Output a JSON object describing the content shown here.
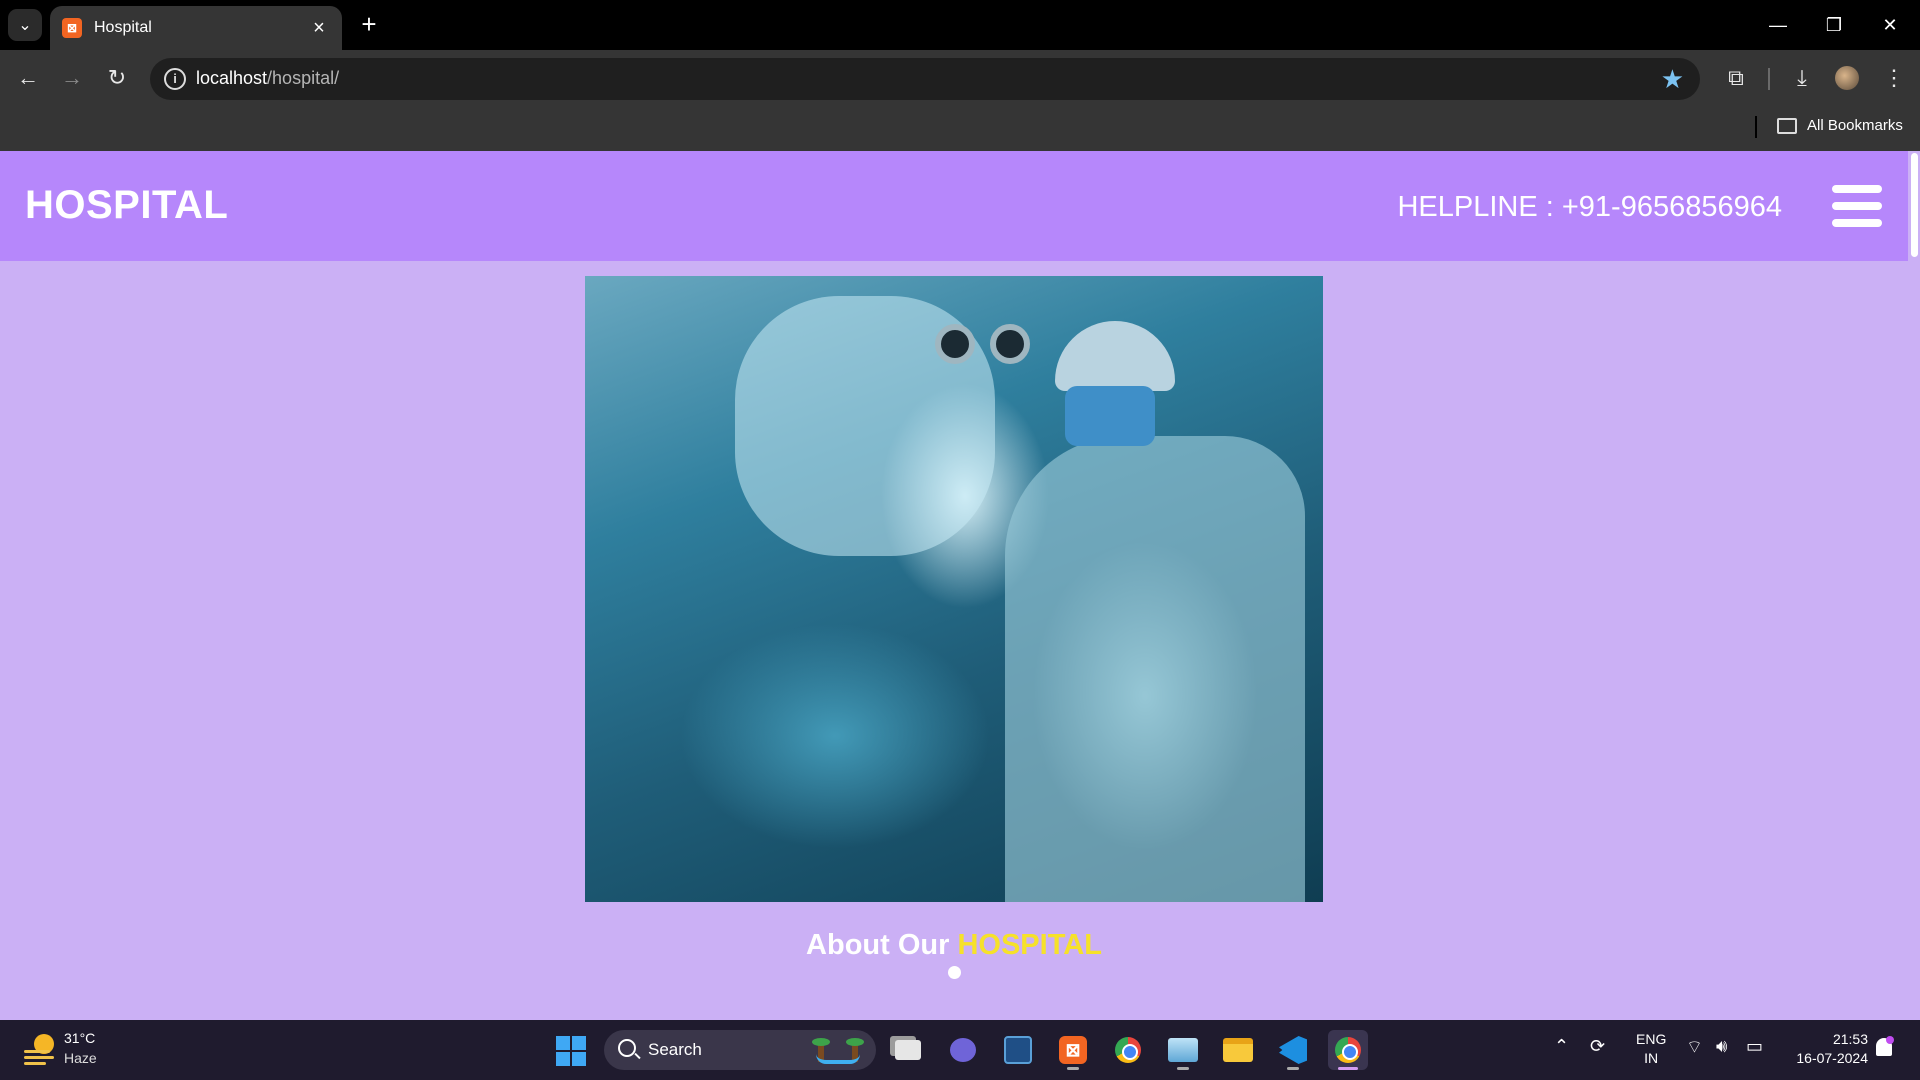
{
  "browser": {
    "tab_title": "Hospital",
    "tab_favicon": "xampp-icon",
    "url_host": "localhost",
    "url_path": "/hospital/",
    "bookmarks_label": "All Bookmarks",
    "bookmark_star_color": "#7cc3f2"
  },
  "site": {
    "logo": "HOSPITAL",
    "helpline": "HELPLINE : +91-9656856964",
    "about_prefix": "About Our ",
    "about_accent": "HOSPITAL",
    "header_color": "#b687fb",
    "page_bg": "#cbb0f5",
    "accent_color": "#f6e12a",
    "hero_image": "surgeon-operating-room-photo"
  },
  "taskbar": {
    "temperature": "31°C",
    "condition": "Haze",
    "search_placeholder": "Search",
    "lang_line1": "ENG",
    "lang_line2": "IN",
    "time": "21:53",
    "date": "16-07-2024",
    "apps": [
      "task-view-icon",
      "teams-icon",
      "mysql-workbench-icon",
      "xampp-icon",
      "chrome-icon",
      "photos-icon",
      "file-explorer-icon",
      "vscode-icon",
      "chrome-icon"
    ]
  }
}
